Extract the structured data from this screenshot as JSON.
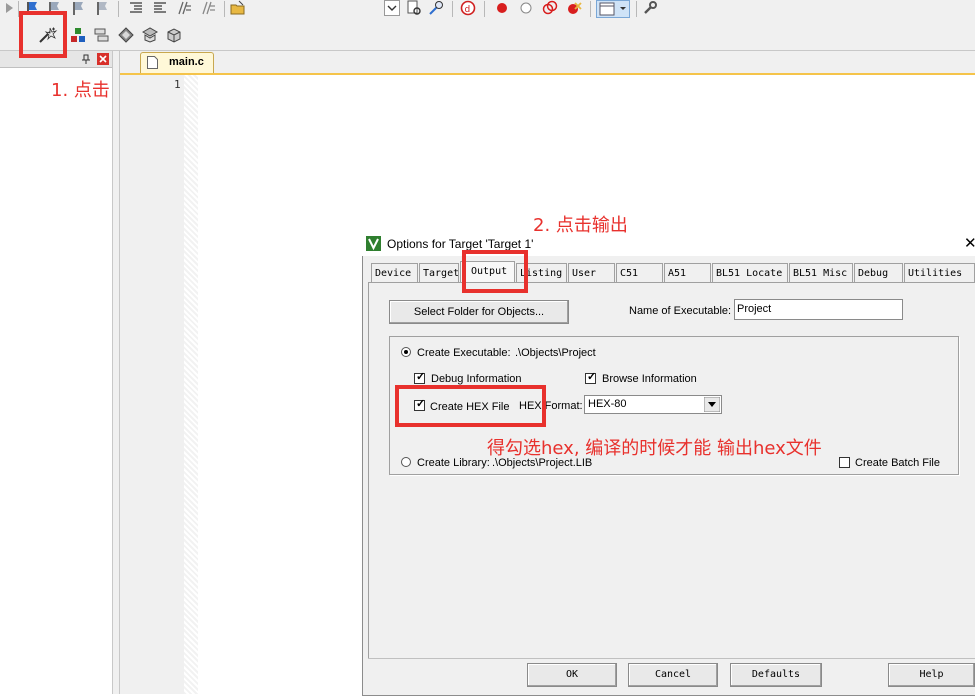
{
  "editor": {
    "tab_label": "main.c",
    "line_number": "1"
  },
  "dialog": {
    "title": "Options for Target 'Target 1'",
    "close_glyph": "✕",
    "tabs": [
      {
        "label": "Device"
      },
      {
        "label": "Target"
      },
      {
        "label": "Output"
      },
      {
        "label": "Listing"
      },
      {
        "label": "User"
      },
      {
        "label": "C51"
      },
      {
        "label": "A51"
      },
      {
        "label": "BL51 Locate"
      },
      {
        "label": "BL51 Misc"
      },
      {
        "label": "Debug"
      },
      {
        "label": "Utilities"
      }
    ],
    "active_tab": "Output",
    "output": {
      "select_folder_button": "Select Folder for Objects...",
      "name_label": "Name of Executable:",
      "name_value": "Project",
      "create_executable_label": "Create Executable:",
      "create_executable_path": ".\\Objects\\Project",
      "debug_info_label": "Debug Information",
      "browse_info_label": "Browse Information",
      "create_hex_label": "Create HEX File",
      "hex_format_label": "HEX Format:",
      "hex_format_value": "HEX-80",
      "create_library_label": "Create Library:",
      "create_library_path": ".\\Objects\\Project.LIB",
      "create_batch_label": "Create Batch File",
      "checks": {
        "debug_info": true,
        "browse_info": true,
        "create_hex": true,
        "create_batch": false
      },
      "radio_selected": "create_executable"
    },
    "buttons": {
      "ok": "OK",
      "cancel": "Cancel",
      "defaults": "Defaults",
      "help": "Help"
    }
  },
  "annotations": {
    "step1": "1. 点击",
    "step2": "2. 点击输出",
    "note": "得勾选hex, 编译的时候才能 输出hex文件"
  },
  "colors": {
    "annotation_red": "#e8312d",
    "toolbar_bg": "#f0f0f0",
    "tab_accent": "#f5c44a"
  }
}
